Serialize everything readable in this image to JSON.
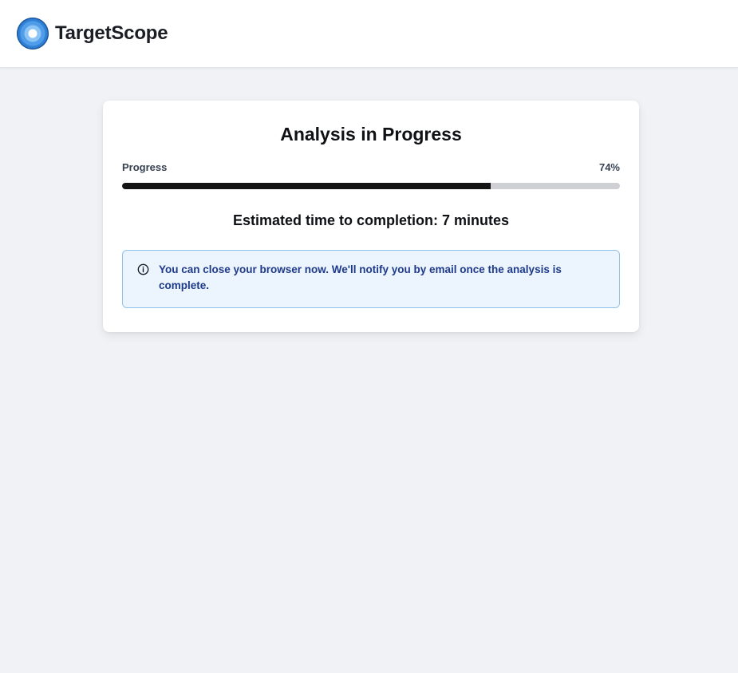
{
  "header": {
    "brand": "TargetScope",
    "logo_icon": "target-logo-icon"
  },
  "card": {
    "title": "Analysis in Progress",
    "progress_label": "Progress",
    "progress_percent_text": "74%",
    "progress_value": 0.74,
    "eta_text": "Estimated time to completion: 7 minutes",
    "notice_icon": "info-icon",
    "notice_text": "You can close your browser now. We'll notify you by email once the analysis is complete."
  },
  "colors": {
    "page_bg": "#f0f2f5",
    "progress_fill": "#141414",
    "progress_track": "#cfd0d3",
    "notice_bg": "#ecf4fd",
    "notice_border": "#8ec2ea",
    "notice_text": "#1e3a8a"
  }
}
